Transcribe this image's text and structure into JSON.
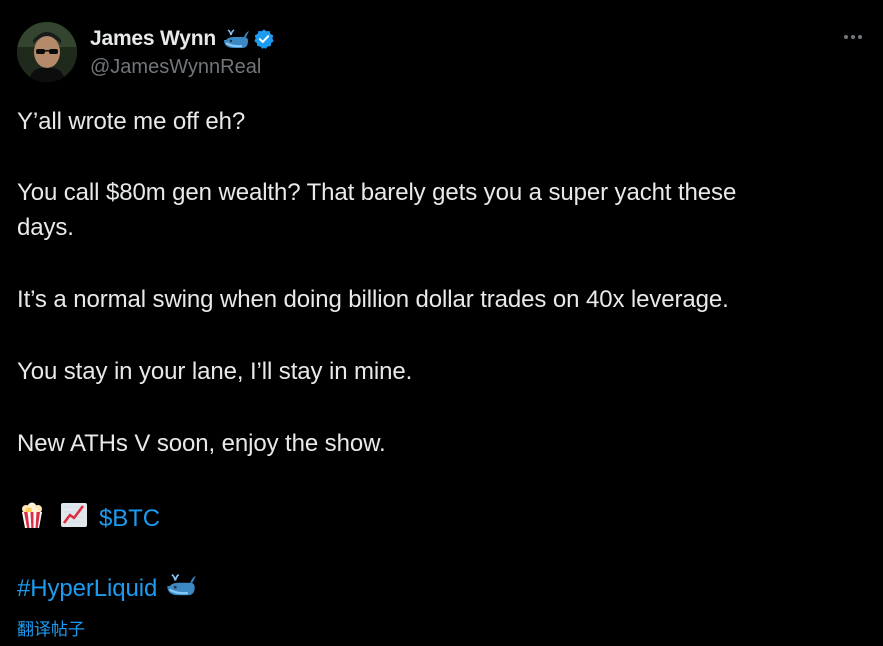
{
  "author": {
    "display_name": "James Wynn",
    "handle": "@JamesWynnReal",
    "name_emoji": "whale-emoji",
    "verified_icon": "verified-badge-icon",
    "verified_color": "#1d9bf0"
  },
  "tweet": {
    "line1": "Y’all wrote me off eh?",
    "line2": "You call $80m gen wealth? That barely gets you a super yacht these",
    "line3": "days.",
    "line4": "It’s a normal swing when doing billion dollar trades on 40x leverage.",
    "line5": "You stay in your lane, I’ll stay in mine.",
    "line6": "New ATHs V soon, enjoy the show.",
    "emoji_popcorn": "popcorn-emoji",
    "emoji_chart": "chart-increasing-emoji",
    "cashtag": "$BTC",
    "hashtag": "#HyperLiquid",
    "hashtag_emoji": "whale-emoji"
  },
  "translate_label": "翻译帖子",
  "more_icon": "more-options-icon",
  "colors": {
    "background": "#000000",
    "text": "#e7e9ea",
    "secondary": "#71767b",
    "link": "#1d9bf0"
  }
}
